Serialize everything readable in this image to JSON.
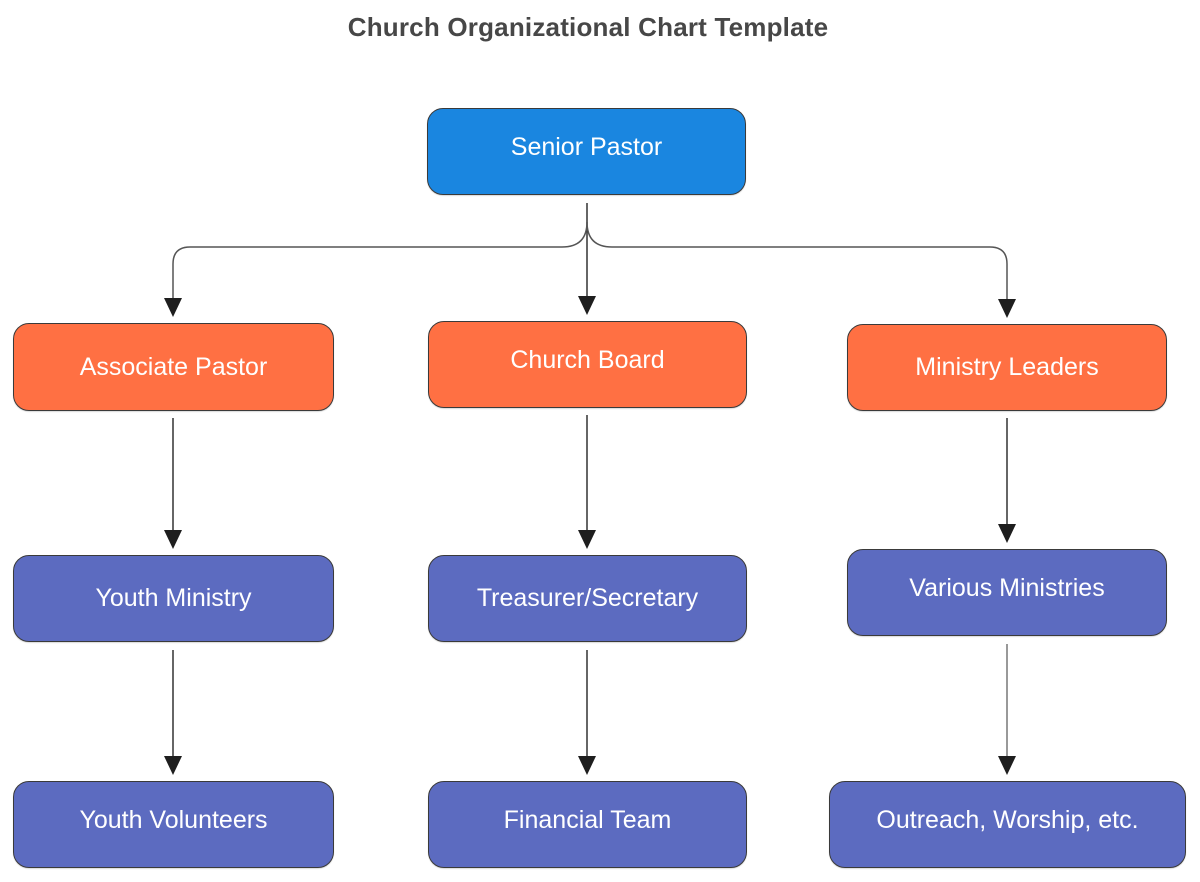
{
  "title": "Church Organizational Chart Template",
  "colors": {
    "level_0": "#1a86e0",
    "level_1": "#ff7043",
    "level_2": "#5c6bc0",
    "connector": "#333333",
    "title_text": "#474747"
  },
  "nodes": {
    "senior_pastor": "Senior Pastor",
    "associate_pastor": "Associate Pastor",
    "church_board": "Church Board",
    "ministry_leaders": "Ministry Leaders",
    "youth_ministry": "Youth Ministry",
    "treasurer_secretary": "Treasurer/Secretary",
    "various_ministries": "Various Ministries",
    "youth_volunteers": "Youth Volunteers",
    "financial_team": "Financial Team",
    "outreach_worship": "Outreach, Worship, etc."
  },
  "edges": [
    {
      "from": "Senior Pastor",
      "to": "Associate Pastor"
    },
    {
      "from": "Senior Pastor",
      "to": "Church Board"
    },
    {
      "from": "Senior Pastor",
      "to": "Ministry Leaders"
    },
    {
      "from": "Associate Pastor",
      "to": "Youth Ministry"
    },
    {
      "from": "Youth Ministry",
      "to": "Youth Volunteers"
    },
    {
      "from": "Church Board",
      "to": "Treasurer/Secretary"
    },
    {
      "from": "Treasurer/Secretary",
      "to": "Financial Team"
    },
    {
      "from": "Ministry Leaders",
      "to": "Various Ministries"
    },
    {
      "from": "Various Ministries",
      "to": "Outreach, Worship, etc."
    }
  ]
}
